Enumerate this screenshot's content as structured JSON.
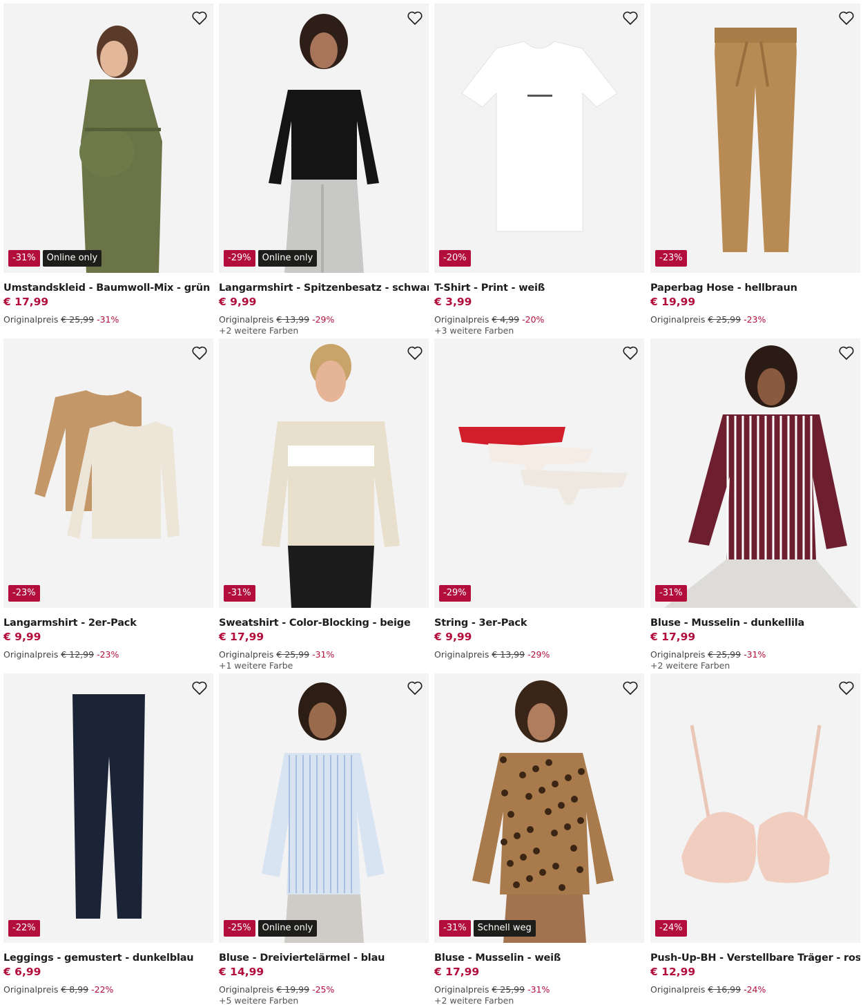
{
  "colors": {
    "accent": "#b30d3c",
    "flag_bg": "#1d1d1b",
    "image_bg": "#f3f3f3"
  },
  "original_label": "Originalpreis",
  "products": [
    {
      "name": "Umstandskleid - Baumwoll-Mix - grün",
      "price": "€ 17,99",
      "old_price": "€ 25,99",
      "discount": "-31%",
      "flag": "Online only",
      "more_colors": "",
      "icon": "dress-icon"
    },
    {
      "name": "Langarmshirt - Spitzenbesatz - schwarz",
      "price": "€ 9,99",
      "old_price": "€ 13,99",
      "discount": "-29%",
      "flag": "Online only",
      "more_colors": "+2 weitere Farben",
      "icon": "shirt-icon"
    },
    {
      "name": "T-Shirt - Print - weiß",
      "price": "€ 3,99",
      "old_price": "€ 4,99",
      "discount": "-20%",
      "flag": "",
      "more_colors": "+3 weitere Farben",
      "icon": "tshirt-icon"
    },
    {
      "name": "Paperbag Hose - hellbraun",
      "price": "€ 19,99",
      "old_price": "€ 25,99",
      "discount": "-23%",
      "flag": "",
      "more_colors": "",
      "icon": "pants-icon"
    },
    {
      "name": "Langarmshirt - 2er-Pack",
      "price": "€ 9,99",
      "old_price": "€ 12,99",
      "discount": "-23%",
      "flag": "",
      "more_colors": "",
      "icon": "longsleeve-icon"
    },
    {
      "name": "Sweatshirt - Color-Blocking - beige",
      "price": "€ 17,99",
      "old_price": "€ 25,99",
      "discount": "-31%",
      "flag": "",
      "more_colors": "+1 weitere Farbe",
      "icon": "hoodie-icon"
    },
    {
      "name": "String - 3er-Pack",
      "price": "€ 9,99",
      "old_price": "€ 13,99",
      "discount": "-29%",
      "flag": "",
      "more_colors": "",
      "icon": "underwear-icon"
    },
    {
      "name": "Bluse - Musselin - dunkellila",
      "price": "€ 17,99",
      "old_price": "€ 25,99",
      "discount": "-31%",
      "flag": "",
      "more_colors": "+2 weitere Farben",
      "icon": "blouse-icon"
    },
    {
      "name": "Leggings - gemustert - dunkelblau",
      "price": "€ 6,99",
      "old_price": "€ 8,99",
      "discount": "-22%",
      "flag": "",
      "more_colors": "",
      "icon": "leggings-icon"
    },
    {
      "name": "Bluse - Dreiviertelärmel - blau",
      "price": "€ 14,99",
      "old_price": "€ 19,99",
      "discount": "-25%",
      "flag": "Online only",
      "more_colors": "+5 weitere Farben",
      "icon": "blouse-icon"
    },
    {
      "name": "Bluse - Musselin - weiß",
      "price": "€ 17,99",
      "old_price": "€ 25,99",
      "discount": "-31%",
      "flag": "Schnell weg",
      "more_colors": "+2 weitere Farben",
      "icon": "blouse-icon"
    },
    {
      "name": "Push-Up-BH - Verstellbare Träger - rosa",
      "price": "€ 12,99",
      "old_price": "€ 16,99",
      "discount": "-24%",
      "flag": "",
      "more_colors": "",
      "icon": "bra-icon"
    }
  ]
}
